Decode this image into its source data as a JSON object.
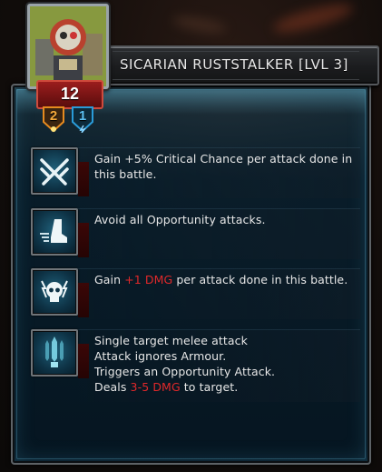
{
  "unit": {
    "name": "SICARIAN RUSTSTALKER [LVL 3]",
    "level": "12",
    "badges": [
      {
        "value": "2",
        "icon": "sun-icon",
        "color": "#e58a1f"
      },
      {
        "value": "1",
        "icon": "lightning-icon",
        "color": "#2a9bd8"
      }
    ]
  },
  "abilities": [
    {
      "icon": "crossed-swords-icon",
      "segments": [
        {
          "text": "Gain +5% Critical Chance per attack done in this battle.",
          "highlight": false
        }
      ]
    },
    {
      "icon": "dash-foot-icon",
      "segments": [
        {
          "text": "Avoid all Opportunity attacks.",
          "highlight": false
        }
      ]
    },
    {
      "icon": "skull-lightning-icon",
      "segments": [
        {
          "text": "Gain ",
          "highlight": false
        },
        {
          "text": "+1 DMG",
          "highlight": true
        },
        {
          "text": " per attack done in this battle.",
          "highlight": false
        }
      ]
    },
    {
      "icon": "blade-attack-icon",
      "lines": [
        "Single target melee attack",
        "Attack ignores Armour.",
        "Triggers an Opportunity Attack."
      ],
      "damage": {
        "prefix": "Deals ",
        "value": "3-5 DMG",
        "suffix": " to target."
      }
    }
  ],
  "colors": {
    "panel": "#0b2636",
    "highlight": "#e0282a",
    "text": "#e7e7e7"
  }
}
